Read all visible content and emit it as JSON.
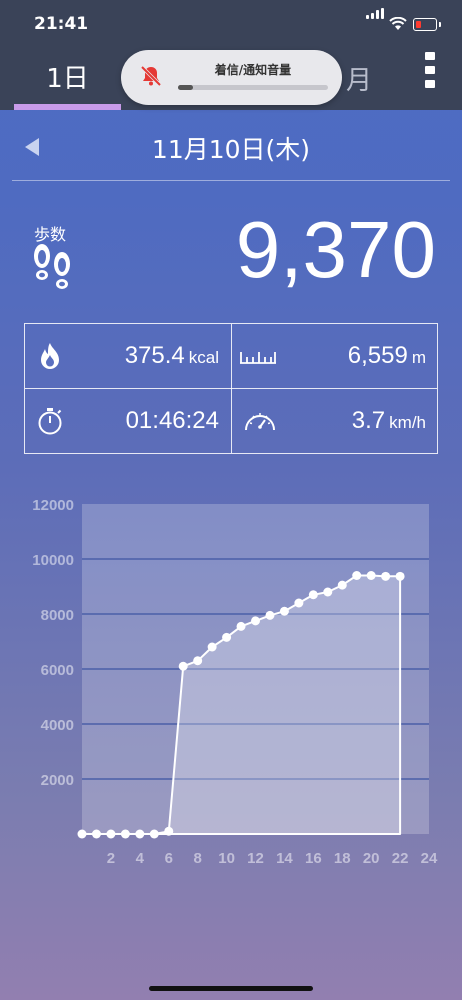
{
  "status": {
    "time": "21:41"
  },
  "tabs": {
    "day": "1日",
    "month": "月"
  },
  "hud": {
    "title": "着信/通知音量",
    "level": 0.1
  },
  "date": "11月10日(木)",
  "steps": {
    "label": "歩数",
    "value": "9,370"
  },
  "stats": {
    "calories": {
      "value": "375.4",
      "unit": "kcal"
    },
    "distance": {
      "value": "6,559",
      "unit": "m"
    },
    "duration": {
      "value": "01:46:24",
      "unit": ""
    },
    "speed": {
      "value": "3.7",
      "unit": "km/h"
    }
  },
  "colors": {
    "accent": "#c89bea",
    "header": "#3a4358"
  },
  "chart_data": {
    "type": "area",
    "x": [
      0,
      1,
      2,
      3,
      4,
      5,
      6,
      7,
      8,
      9,
      10,
      11,
      12,
      13,
      14,
      15,
      16,
      17,
      18,
      19,
      20,
      21,
      22
    ],
    "values": [
      0,
      0,
      0,
      0,
      0,
      0,
      100,
      6100,
      6300,
      6800,
      7150,
      7550,
      7750,
      7950,
      8100,
      8400,
      8700,
      8800,
      9050,
      9400,
      9400,
      9370,
      9370
    ],
    "xticks": [
      2,
      4,
      6,
      8,
      10,
      12,
      14,
      16,
      18,
      20,
      22,
      24
    ],
    "yticks": [
      2000,
      4000,
      6000,
      8000,
      10000,
      12000
    ],
    "xlim": [
      0,
      24
    ],
    "ylim": [
      0,
      12000
    ],
    "grid": true
  }
}
